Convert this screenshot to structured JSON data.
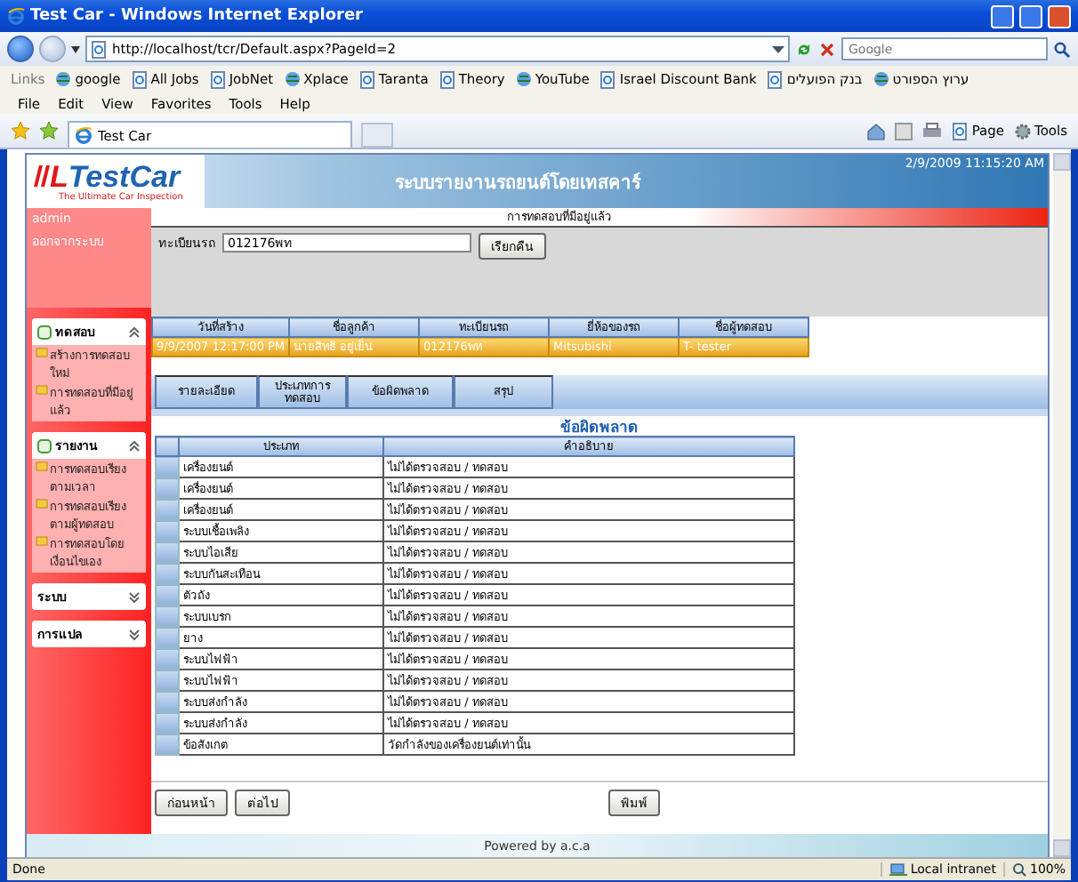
{
  "window": {
    "title": "Test Car - Windows Internet Explorer",
    "address": "http://localhost/tcr/Default.aspx?PageId=2",
    "search": {
      "placeholder": "Google"
    }
  },
  "links_bar": {
    "label": "Links",
    "items": [
      "google",
      "All Jobs",
      "JobNet",
      "Xplace",
      "Taranta",
      "Theory",
      "YouTube",
      "Israel Discount Bank",
      "בנק הפועלים",
      "ערוץ הספורט"
    ]
  },
  "menu": [
    "File",
    "Edit",
    "View",
    "Favorites",
    "Tools",
    "Help"
  ],
  "tabs": [
    {
      "label": "Test Car",
      "selected": true
    }
  ],
  "command_bar": [
    "Page",
    "Tools"
  ],
  "header": {
    "logo_mark": "L",
    "logo": "TestCar",
    "tagline": "The Ultimate Car Inspection",
    "title": "ระบบรายงานรถยนต์โดยเทสคาร์",
    "datetime": "2/9/2009 11:15:20 AM"
  },
  "sidebar": {
    "user": "admin",
    "logout": "ออกจากระบบ",
    "panels": [
      {
        "title": "ทดสอบ",
        "expanded": true,
        "items": [
          "สร้างการทดสอบใหม่",
          "การทดสอบที่มีอยู่แล้ว"
        ]
      },
      {
        "title": "รายงาน",
        "expanded": true,
        "items": [
          "การทดสอบเรียงตามเวลา",
          "การทดสอบเรียงตามผู้ทดสอบ",
          "การทดสอบโดยเงื่อนไขเอง"
        ]
      },
      {
        "title": "ระบบ",
        "expanded": false
      },
      {
        "title": "การแปล",
        "expanded": false
      }
    ]
  },
  "breadcrumb": "การทดสอบที่มีอยู่แล้ว",
  "search_form": {
    "label": "ทะเบียนรถ",
    "value": "012176พท",
    "button": "เรียกคืน"
  },
  "results": {
    "columns": [
      "วันที่สร้าง",
      "ชื่อลูกค้า",
      "ทะเบียนรถ",
      "ยี่ห้อของรถ",
      "ชื่อผู้ทดสอบ"
    ],
    "rows": [
      {
        "selected": true,
        "cells": [
          "9/9/2007 12:17:00 PM",
          "นายสิทธิ อยู่เย็น",
          "012176พท",
          "Mitsubishi",
          "T- tester"
        ]
      }
    ]
  },
  "detail_tabs": [
    "รายละเอียด",
    "ประเภทการทดสอบ",
    "ข้อผิดพลาด",
    "สรุป"
  ],
  "section_title": "ข้อผิดพลาด",
  "errors": {
    "columns": [
      "ประเภท",
      "คำอธิบาย"
    ],
    "rows": [
      {
        "type": "เครื่องยนต์",
        "description": "ไม่ได้ตรวจสอบ / ทดสอบ"
      },
      {
        "type": "เครื่องยนต์",
        "description": "ไม่ได้ตรวจสอบ / ทดสอบ"
      },
      {
        "type": "เครื่องยนต์",
        "description": "ไม่ได้ตรวจสอบ / ทดสอบ"
      },
      {
        "type": "ระบบเชื้อเพลิง",
        "description": "ไม่ได้ตรวจสอบ / ทดสอบ"
      },
      {
        "type": "ระบบไอเสีย",
        "description": "ไม่ได้ตรวจสอบ / ทดสอบ"
      },
      {
        "type": "ระบบกันสะเทือน",
        "description": "ไม่ได้ตรวจสอบ / ทดสอบ"
      },
      {
        "type": "ตัวถัง",
        "description": "ไม่ได้ตรวจสอบ / ทดสอบ"
      },
      {
        "type": "ระบบเบรก",
        "description": "ไม่ได้ตรวจสอบ / ทดสอบ"
      },
      {
        "type": "ยาง",
        "description": "ไม่ได้ตรวจสอบ / ทดสอบ"
      },
      {
        "type": "ระบบไฟฟ้า",
        "description": "ไม่ได้ตรวจสอบ / ทดสอบ"
      },
      {
        "type": "ระบบไฟฟ้า",
        "description": "ไม่ได้ตรวจสอบ / ทดสอบ"
      },
      {
        "type": "ระบบส่งกำลัง",
        "description": "ไม่ได้ตรวจสอบ / ทดสอบ"
      },
      {
        "type": "ระบบส่งกำลัง",
        "description": "ไม่ได้ตรวจสอบ / ทดสอบ"
      },
      {
        "type": "ข้อสังเกต",
        "description": "วัดกำลังของเครื่องยนต์เท่านั้น"
      }
    ]
  },
  "buttons": {
    "previous": "ก่อนหน้า",
    "next": "ต่อไป",
    "print": "พิมพ์"
  },
  "footer": "Powered by a.c.a",
  "status_bar": {
    "text": "Done",
    "zone": "Local intranet",
    "zoom": "100%"
  }
}
